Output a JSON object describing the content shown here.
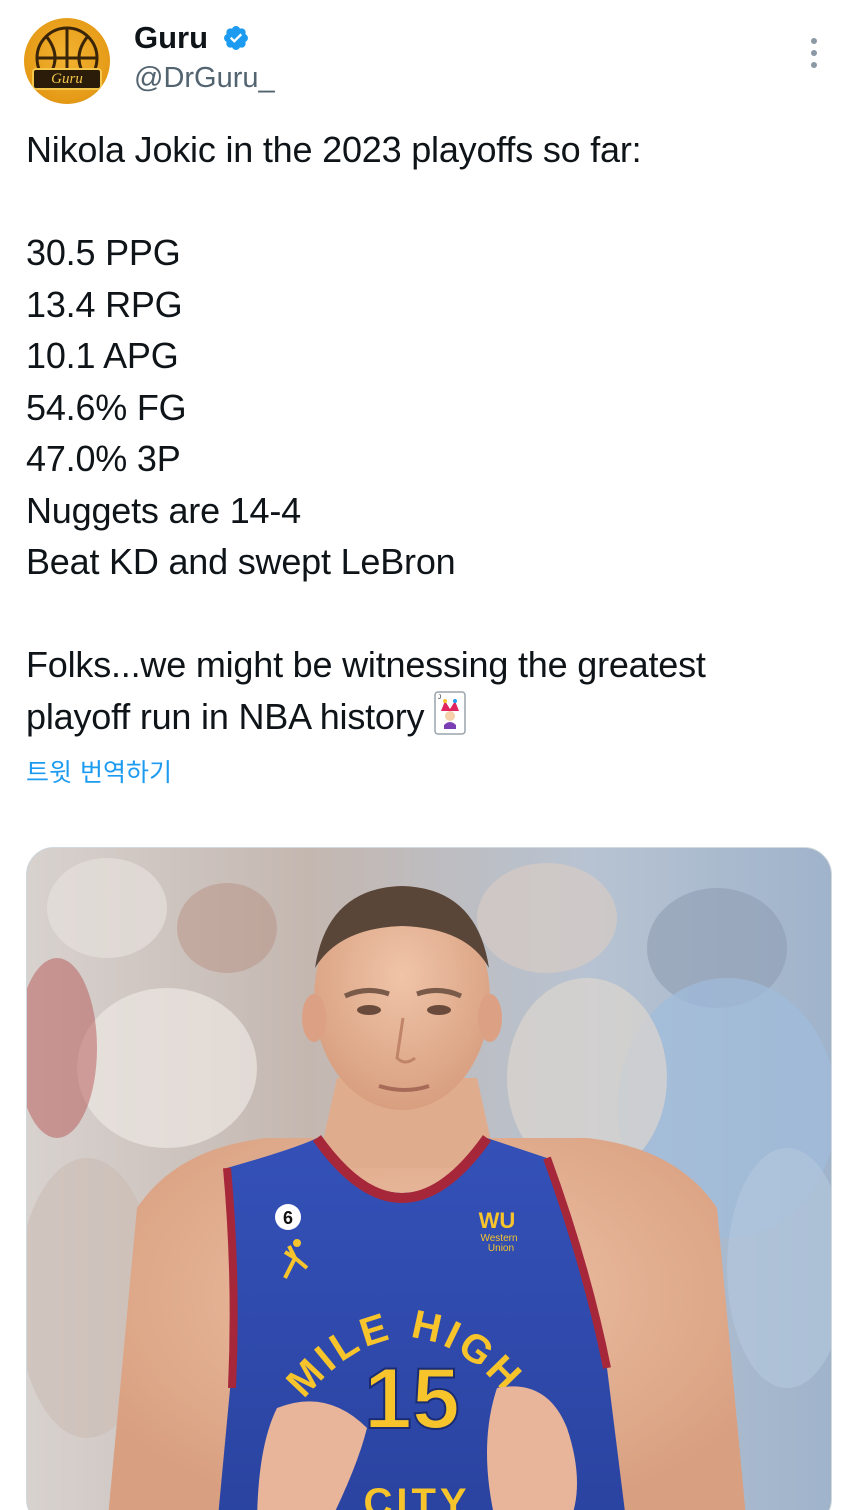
{
  "author": {
    "display_name": "Guru",
    "handle": "@DrGuru_",
    "avatar_badge": "Guru",
    "verified": true
  },
  "tweet": {
    "lines": [
      "Nikola Jokic in the 2023 playoffs so far:",
      "",
      "30.5 PPG",
      "13.4 RPG",
      "10.1 APG",
      "54.6% FG",
      "47.0% 3P",
      "Nuggets are 14-4",
      "Beat KD and swept LeBron",
      "",
      "Folks...we might be witnessing the greatest",
      "playoff run in NBA history"
    ],
    "emoji": "joker-card-icon"
  },
  "translate_label": "트윗 번역하기",
  "media": {
    "description_icon": "photo",
    "jersey": {
      "number": "15",
      "patch_number": "6",
      "sponsor_logo": "WU",
      "sponsor_text_1": "Western",
      "sponsor_text_2": "Union",
      "arc_text": "MILE HIGH",
      "bottom_text": "CITY"
    }
  },
  "colors": {
    "accent": "#1d9bf0",
    "text": "#0f1419",
    "secondary": "#536471",
    "jersey_blue": "#2c4ab0",
    "jersey_yellow": "#f7c52b",
    "jersey_red": "#a6273a"
  }
}
